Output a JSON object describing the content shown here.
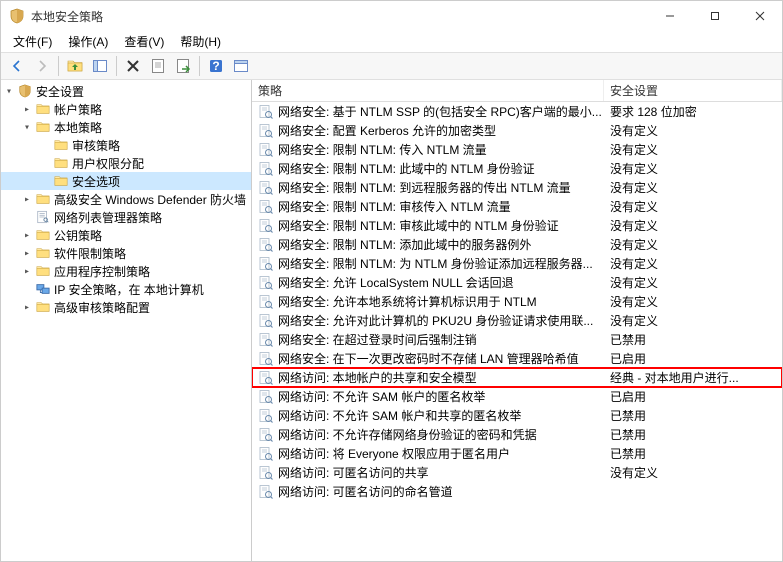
{
  "window": {
    "title": "本地安全策略"
  },
  "menu": {
    "file": "文件(F)",
    "action": "操作(A)",
    "view": "查看(V)",
    "help": "帮助(H)"
  },
  "tree": {
    "root": "安全设置",
    "items": [
      {
        "label": "帐户策略",
        "expanded": false,
        "children": []
      },
      {
        "label": "本地策略",
        "expanded": true,
        "children": [
          {
            "label": "审核策略"
          },
          {
            "label": "用户权限分配"
          },
          {
            "label": "安全选项",
            "selected": true
          }
        ]
      },
      {
        "label": "高级安全 Windows Defender 防火墙",
        "expanded": false
      },
      {
        "label": "网络列表管理器策略",
        "leaf": true
      },
      {
        "label": "公钥策略",
        "expanded": false
      },
      {
        "label": "软件限制策略",
        "expanded": false
      },
      {
        "label": "应用程序控制策略",
        "expanded": false
      },
      {
        "label": "IP 安全策略，在 本地计算机",
        "icon": "ip"
      },
      {
        "label": "高级审核策略配置",
        "expanded": false
      }
    ]
  },
  "list": {
    "col1": "策略",
    "col2": "安全设置",
    "rows": [
      {
        "policy": "网络安全: 基于 NTLM SSP 的(包括安全 RPC)客户端的最小...",
        "setting": "要求 128 位加密"
      },
      {
        "policy": "网络安全: 配置 Kerberos 允许的加密类型",
        "setting": "没有定义"
      },
      {
        "policy": "网络安全: 限制 NTLM: 传入 NTLM 流量",
        "setting": "没有定义"
      },
      {
        "policy": "网络安全: 限制 NTLM: 此域中的 NTLM 身份验证",
        "setting": "没有定义"
      },
      {
        "policy": "网络安全: 限制 NTLM: 到远程服务器的传出 NTLM 流量",
        "setting": "没有定义"
      },
      {
        "policy": "网络安全: 限制 NTLM: 审核传入 NTLM 流量",
        "setting": "没有定义"
      },
      {
        "policy": "网络安全: 限制 NTLM: 审核此域中的 NTLM 身份验证",
        "setting": "没有定义"
      },
      {
        "policy": "网络安全: 限制 NTLM: 添加此域中的服务器例外",
        "setting": "没有定义"
      },
      {
        "policy": "网络安全: 限制 NTLM: 为 NTLM 身份验证添加远程服务器...",
        "setting": "没有定义"
      },
      {
        "policy": "网络安全: 允许 LocalSystem NULL 会话回退",
        "setting": "没有定义"
      },
      {
        "policy": "网络安全: 允许本地系统将计算机标识用于 NTLM",
        "setting": "没有定义"
      },
      {
        "policy": "网络安全: 允许对此计算机的 PKU2U 身份验证请求使用联...",
        "setting": "没有定义"
      },
      {
        "policy": "网络安全: 在超过登录时间后强制注销",
        "setting": "已禁用"
      },
      {
        "policy": "网络安全: 在下一次更改密码时不存储 LAN 管理器哈希值",
        "setting": "已启用"
      },
      {
        "policy": "网络访问: 本地帐户的共享和安全模型",
        "setting": "经典 - 对本地用户进行...",
        "highlight": true
      },
      {
        "policy": "网络访问: 不允许 SAM 帐户的匿名枚举",
        "setting": "已启用"
      },
      {
        "policy": "网络访问: 不允许 SAM 帐户和共享的匿名枚举",
        "setting": "已禁用"
      },
      {
        "policy": "网络访问: 不允许存储网络身份验证的密码和凭据",
        "setting": "已禁用"
      },
      {
        "policy": "网络访问: 将 Everyone 权限应用于匿名用户",
        "setting": "已禁用"
      },
      {
        "policy": "网络访问: 可匿名访问的共享",
        "setting": "没有定义"
      },
      {
        "policy": "网络访问: 可匿名访问的命名管道",
        "setting": ""
      }
    ]
  }
}
